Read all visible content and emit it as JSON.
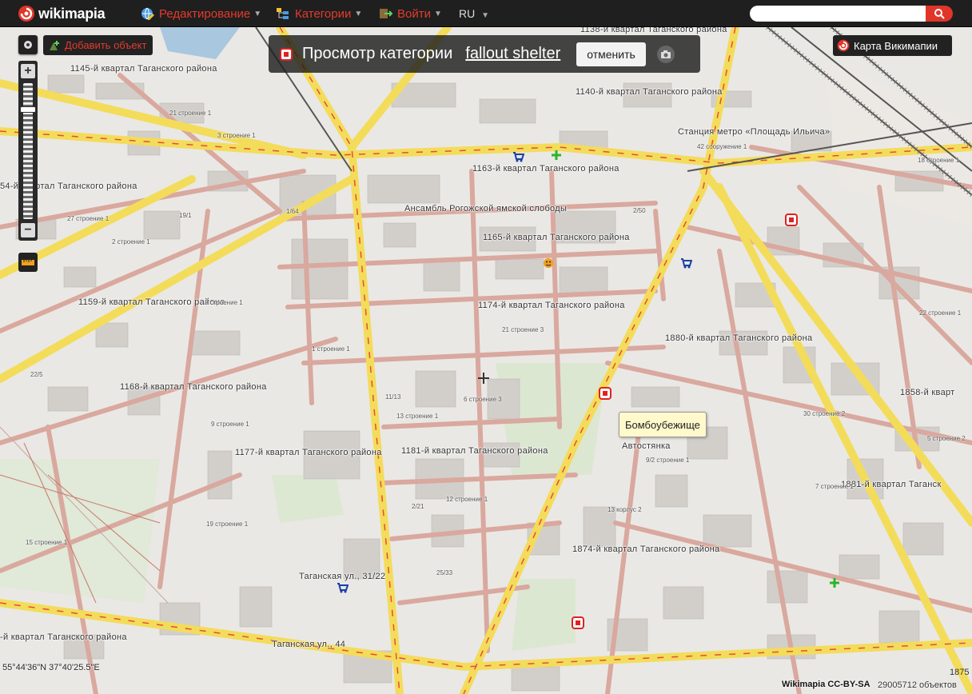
{
  "header": {
    "logo_text": "wikimapia",
    "menu_edit": "Редактирование",
    "menu_categories": "Категории",
    "menu_login": "Войти",
    "lang": "RU",
    "search_value": ""
  },
  "controls": {
    "add_object": "Добавить объект",
    "zoom_in": "+",
    "zoom_out": "−",
    "zoom_level_fraction": 0.18
  },
  "category_bar": {
    "label": "Просмотр категории",
    "category_name": "fallout shelter",
    "cancel_label": "отменить"
  },
  "map_button": "Карта Викимапии",
  "tooltip": "Бомбоубежище",
  "footer": {
    "coords": "55°44'36\"N 37°40'25.5\"E",
    "credit": "Wikimapia CC-BY-SA",
    "object_count": "29005712 объектов",
    "edge_num": "1875"
  },
  "places": [
    "1138-й квартал Таганского района",
    "1145-й квартал Таганского района",
    "1140-й квартал Таганского района",
    "Станция метро «Площадь Ильича»",
    "1163-й квартал Таганского района",
    "54-й квартал Таганского района",
    "Ансамбль Рогожской ямской слободы",
    "1165-й квартал Таганского района",
    "1159-й квартал Таганского района",
    "1174-й квартал Таганского района",
    "1880-й квартал Таганского района",
    "1168-й квартал Таганского района",
    "1858-й кварт",
    "Автостянка",
    "1177-й квартал Таганского района",
    "1181-й квартал Таганского района",
    "1881-й квартал Таганск",
    "1874-й квартал Таганского района",
    "Таганская ул., 31/22",
    "-й квартал Таганского района",
    "Таганская ул., 44"
  ],
  "small_labels": [
    "27 строение 1",
    "21 строение 1",
    "2 строение 1",
    "3 строение 1",
    "1 строение 1",
    "42 сооружение 1",
    "8 строение 1",
    "12 строение 1",
    "9 строение 1",
    "6 строение 3",
    "19 строение 1",
    "15 строение 1",
    "22 строение 1",
    "13 корпус 2",
    "5 строение 2",
    "7 строение 1",
    "18 строение 1",
    "30 строение 2",
    "19/1",
    "22/5",
    "11/13",
    "2/21",
    "25/33",
    "2/50",
    "1/64",
    "13 строение 1",
    "21 строение 3",
    "9/2 строение 1"
  ]
}
